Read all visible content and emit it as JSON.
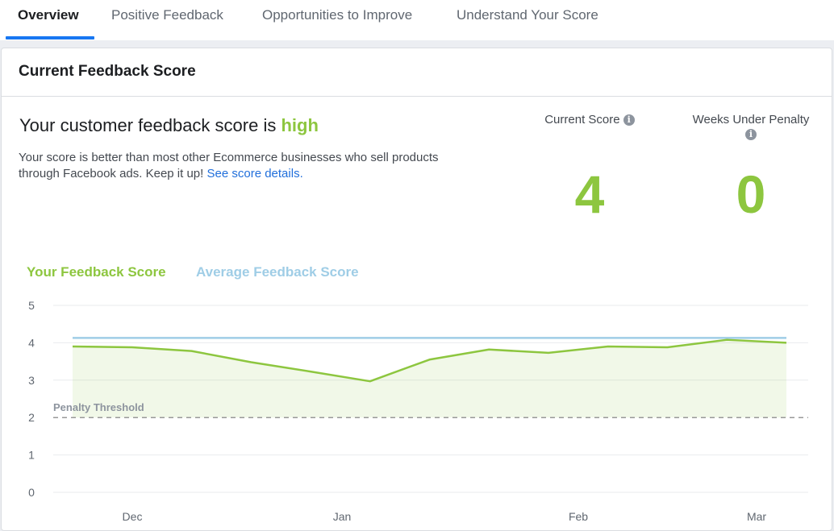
{
  "tabs": [
    {
      "label": "Overview",
      "active": true
    },
    {
      "label": "Positive Feedback",
      "active": false
    },
    {
      "label": "Opportunities to Improve",
      "active": false
    },
    {
      "label": "Understand Your Score",
      "active": false
    }
  ],
  "panel": {
    "title": "Current Feedback Score",
    "headline_prefix": "Your customer feedback score is ",
    "headline_level": "high",
    "description": "Your score is better than most other Ecommerce businesses who sell products through Facebook ads. Keep it up! ",
    "details_link": "See score details."
  },
  "metrics": {
    "current_score": {
      "label": "Current Score",
      "value": "4"
    },
    "weeks_under_penalty": {
      "label": "Weeks Under Penalty",
      "value": "0"
    }
  },
  "info_icon": {
    "glyph": "i",
    "icon": "info-icon"
  },
  "colors": {
    "your_score": "#8dc63f",
    "average_score": "#9fcde6",
    "link": "#216fdb",
    "tab_active_underline": "#1877f2",
    "penalty_line": "#999999"
  },
  "chart_data": {
    "type": "line",
    "series": [
      {
        "name": "Your Feedback Score",
        "values": [
          3.9,
          3.88,
          3.78,
          3.48,
          3.23,
          2.97,
          3.55,
          3.82,
          3.73,
          3.9,
          3.88,
          4.08,
          4.0
        ]
      },
      {
        "name": "Average Feedback Score",
        "values": [
          4.13,
          4.13,
          4.13,
          4.13,
          4.13,
          4.13,
          4.13,
          4.13,
          4.13,
          4.13,
          4.13,
          4.13,
          4.13
        ]
      }
    ],
    "x_ticks": [
      "Dec",
      "Jan",
      "Feb",
      "Mar"
    ],
    "y_ticks": [
      0,
      1,
      2,
      3,
      4,
      5
    ],
    "ylim": [
      0,
      5
    ],
    "threshold": {
      "label": "Penalty Threshold",
      "value": 2
    },
    "grid": true,
    "legend_placement": "top-left"
  }
}
